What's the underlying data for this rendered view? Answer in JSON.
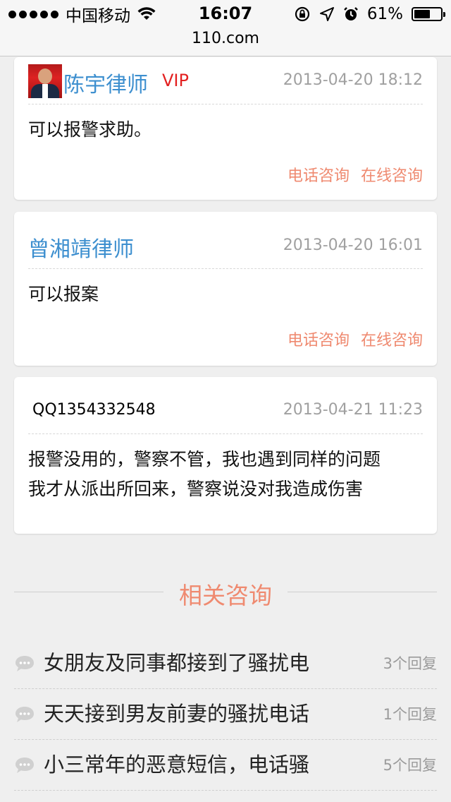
{
  "status_bar": {
    "carrier": "中国移动",
    "time": "16:07",
    "battery_text": "61%",
    "battery_level": 0.61,
    "icons": [
      "signal-dots",
      "wifi-icon",
      "rotation-lock-icon",
      "location-arrow-icon",
      "alarm-icon",
      "battery-icon"
    ]
  },
  "url_bar": {
    "domain": "110.com"
  },
  "answers": [
    {
      "author": "陈宇律师",
      "badge": "VIP",
      "timestamp": "2013-04-20 18:12",
      "content": "可以报警求助。",
      "actions": [
        "电话咨询",
        "在线咨询"
      ]
    },
    {
      "author": "曾湘靖律师",
      "timestamp": "2013-04-20 16:01",
      "content": "可以报案",
      "actions": [
        "电话咨询",
        "在线咨询"
      ]
    },
    {
      "author": "QQ1354332548",
      "timestamp": "2013-04-21 11:23",
      "content_lines": [
        "报警没用的，警察不管，我也遇到同样的问题",
        "我才从派出所回来，警察说没对我造成伤害"
      ]
    }
  ],
  "related": {
    "title": "相关咨询",
    "items": [
      {
        "question": "女朋友及同事都接到了骚扰电",
        "replies": "3个回复"
      },
      {
        "question": "天天接到男友前妻的骚扰电话",
        "replies": "1个回复"
      },
      {
        "question": "小三常年的恶意短信，电话骚",
        "replies": "5个回复"
      }
    ]
  },
  "colors": {
    "page_bg": "#efefef",
    "lawyer_name": "#3d8fcf",
    "vip": "#e32020",
    "action_link": "#ef8a70",
    "related_title": "#ef8a70",
    "timestamp": "#a0a0a0"
  }
}
